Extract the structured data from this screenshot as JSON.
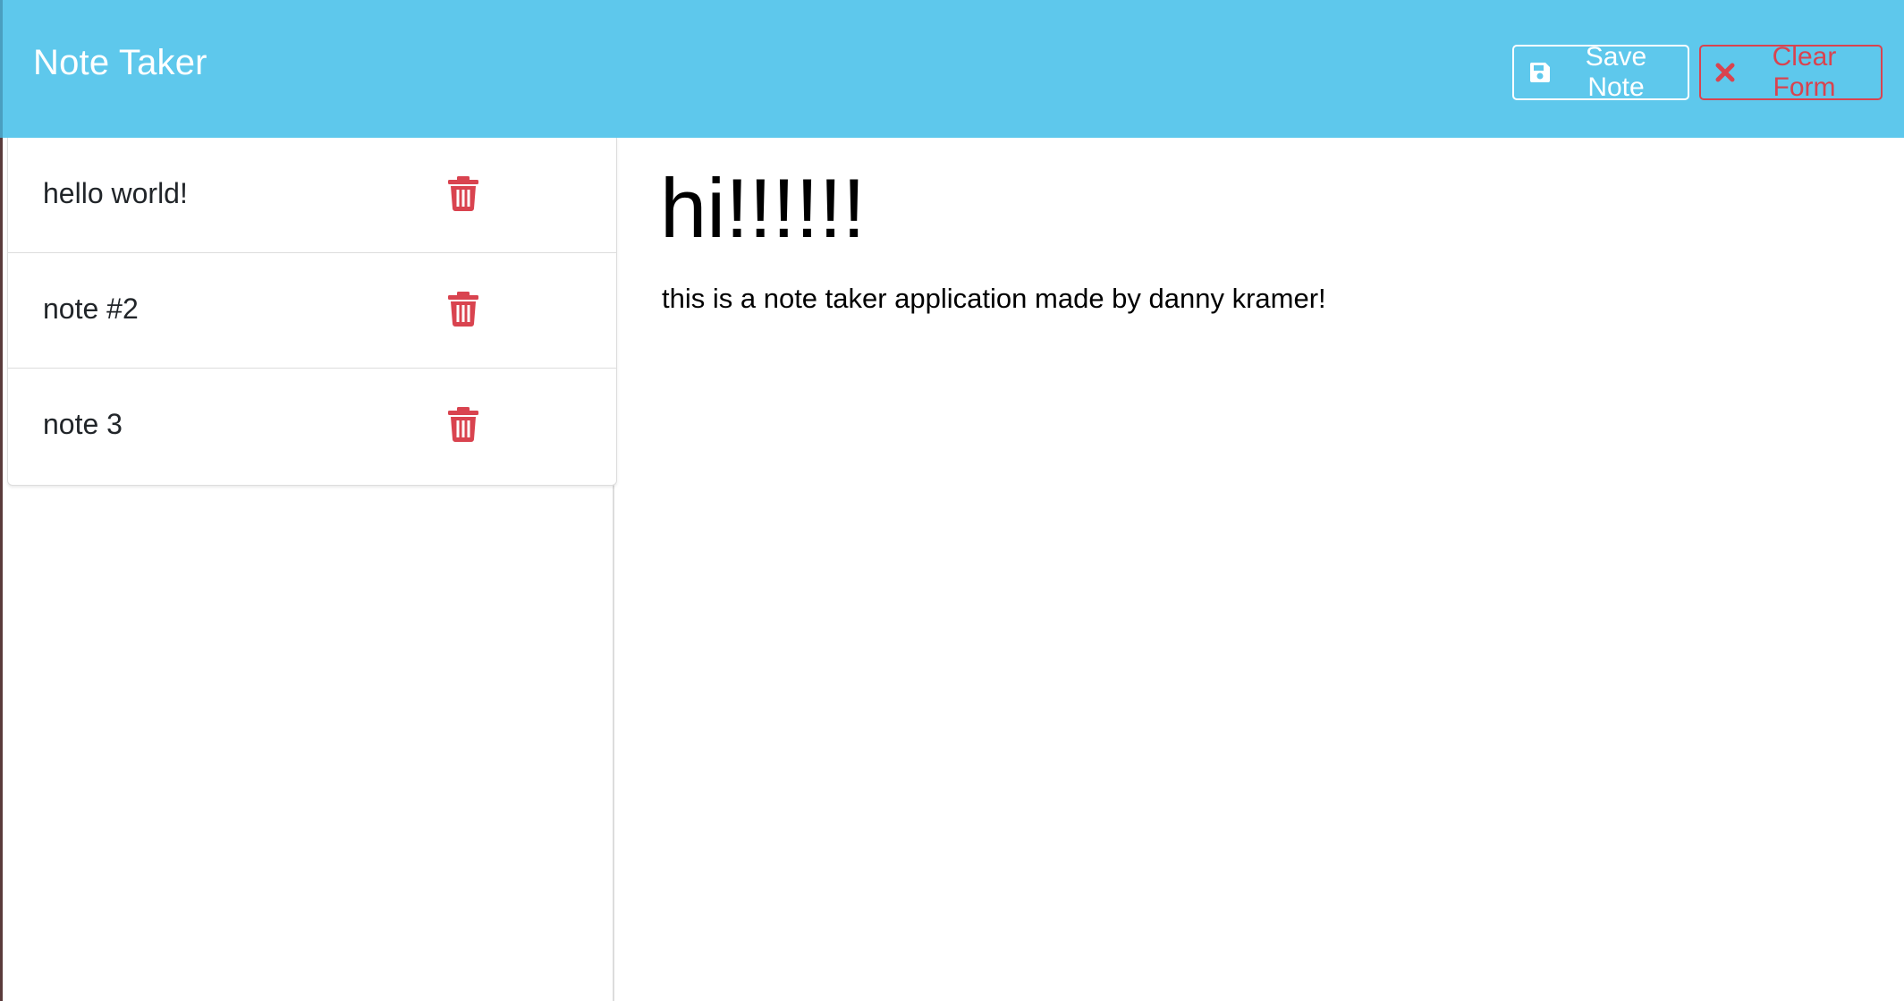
{
  "colors": {
    "navbar_bg": "#5ec8ec",
    "danger": "#d9434f",
    "white": "#ffffff"
  },
  "header": {
    "brand": "Note Taker",
    "save_label": "Save Note",
    "save_icon": "floppy-disk-icon",
    "clear_label": "Clear Form",
    "clear_icon": "times-icon"
  },
  "sidebar": {
    "notes": [
      {
        "title": "hello world!",
        "icon": "trash-icon"
      },
      {
        "title": "note #2",
        "icon": "trash-icon"
      },
      {
        "title": "note 3",
        "icon": "trash-icon"
      }
    ]
  },
  "main": {
    "note_title": "hi!!!!!!",
    "note_text": "this is a note taker application made by danny kramer!"
  }
}
